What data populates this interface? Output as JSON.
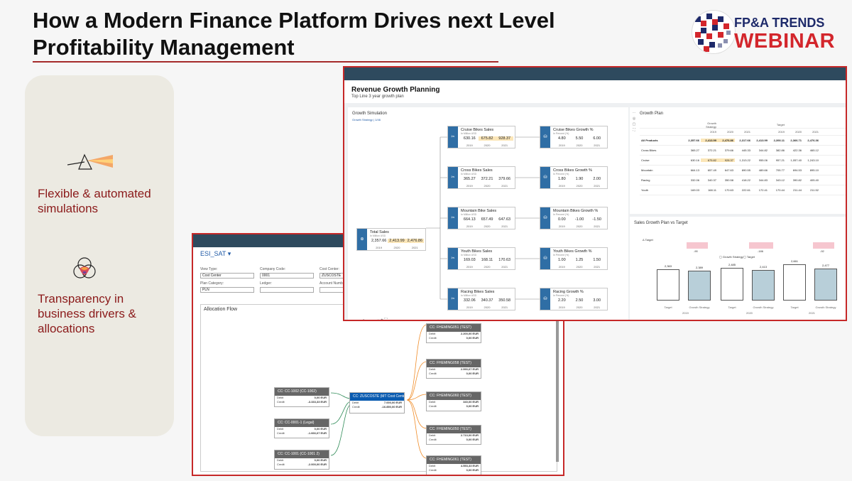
{
  "slide": {
    "title_line1": "How a Modern Finance Platform Drives next Level",
    "title_line2": "Profitability Management"
  },
  "logo": {
    "line1": "FP&A TRENDS",
    "line2": "WEBINAR"
  },
  "side_panel": {
    "feature1_line1": "Flexible & automated",
    "feature1_line2": "simulations",
    "feature2_line1": "Transparency in",
    "feature2_line2": "business drivers &",
    "feature2_line3": "allocations",
    "icon1": "prism-icon",
    "icon2": "venn-icon"
  },
  "colors": {
    "accent_red": "#a52a2a",
    "shell_bar": "#2e4a5e",
    "node_blue": "#2f6ea5",
    "highlight": "#fbe6b8"
  },
  "revenue_app": {
    "title": "Revenue Growth Planning",
    "subtitle": "Top Line 3 year growth plan",
    "simulation": {
      "title": "Growth Simulation",
      "subtitle": "Growth Strategy | 1/46",
      "total": {
        "name": "Total Sales",
        "unit": "In Million USD",
        "values": [
          "2,357.66",
          "2,413.99",
          "2,476.86"
        ],
        "years": [
          "2019",
          "2020",
          "2021"
        ]
      },
      "sales": [
        {
          "name": "Cruise Bikes Sales",
          "unit": "In Million USD",
          "values": [
            "630.16",
            "675.82",
            "928.37"
          ],
          "years": [
            "2019",
            "2020",
            "2021"
          ]
        },
        {
          "name": "Cross Bikes Sales",
          "unit": "In Million USD",
          "values": [
            "365.27",
            "372.21",
            "379.66"
          ],
          "years": [
            "2019",
            "2020",
            "2021"
          ]
        },
        {
          "name": "Mountain Bike Sales",
          "unit": "In Million USD",
          "values": [
            "664.13",
            "657.49",
            "647.63"
          ],
          "years": [
            "2019",
            "2020",
            "2021"
          ]
        },
        {
          "name": "Youth Bikes Sales",
          "unit": "In Million USD",
          "values": [
            "169.03",
            "168.11",
            "170.63"
          ],
          "years": [
            "2019",
            "2020",
            "2021"
          ]
        },
        {
          "name": "Racing Bikes Sales",
          "unit": "In Million USD",
          "values": [
            "332.06",
            "340.37",
            "350.58"
          ],
          "years": [
            "2019",
            "2020",
            "2021"
          ]
        }
      ],
      "growth": [
        {
          "name": "Cruise Bikes Growth %",
          "unit": "In Percent (%)",
          "values": [
            "4.80",
            "5.50",
            "6.00"
          ],
          "years": [
            "2019",
            "2020",
            "2021"
          ]
        },
        {
          "name": "Cross Bikes Growth %",
          "unit": "In Percent (%)",
          "values": [
            "1.80",
            "1.90",
            "2.00"
          ],
          "years": [
            "2019",
            "2020",
            "2021"
          ]
        },
        {
          "name": "Mountain Bikes Growth %",
          "unit": "In Percent (%)",
          "values": [
            "0.00",
            "-1.00",
            "-1.50"
          ],
          "years": [
            "2019",
            "2020",
            "2021"
          ]
        },
        {
          "name": "Youth Bikes Growth %",
          "unit": "In Percent (%)",
          "values": [
            "1.00",
            "1.25",
            "1.50"
          ],
          "years": [
            "2019",
            "2020",
            "2021"
          ]
        },
        {
          "name": "Racing Growth %",
          "unit": "In Percent (%)",
          "values": [
            "2.20",
            "2.50",
            "3.00"
          ],
          "years": [
            "2019",
            "2020",
            "2021"
          ]
        }
      ]
    },
    "growth_plan": {
      "title": "Growth Plan",
      "groups": [
        "Growth Strategy",
        "Target"
      ],
      "years": [
        "2019",
        "2020",
        "2021",
        "2019",
        "2020",
        "2021"
      ],
      "rows": [
        {
          "label": "All Products",
          "cells": [
            "2,357.66",
            "2,413.99",
            "2,476.86",
            "2,317.66",
            "2,413.99",
            "2,393.11",
            "2,366.71",
            "2,476.36"
          ]
        },
        {
          "label": "Cross Bikes",
          "cells": [
            "365.27",
            "372.21",
            "379.66",
            "445.33",
            "344.82",
            "382.86",
            "422.36",
            "465.12"
          ]
        },
        {
          "label": "Cruise",
          "cells": [
            "630.16",
            "675.82",
            "928.37",
            "1,313.22",
            "955.06",
            "957.21",
            "1,057.40",
            "1,243.10"
          ]
        },
        {
          "label": "Mountain",
          "cells": [
            "664.13",
            "657.49",
            "647.63",
            "890.55",
            "489.66",
            "705.77",
            "694.53",
            "895.10"
          ]
        },
        {
          "label": "Racing",
          "cells": [
            "332.06",
            "340.37",
            "350.58",
            "418.22",
            "344.83",
            "343.12",
            "390.82",
            "405.40"
          ]
        },
        {
          "label": "Youth",
          "cells": [
            "169.03",
            "168.11",
            "170.63",
            "222.61",
            "172.41",
            "170.44",
            "211.44",
            "211.52"
          ]
        }
      ]
    },
    "sales_growth": {
      "title": "Sales Growth Plan vs Target",
      "target_label": "Δ Target",
      "deltas": [
        "-90",
        "-186",
        "-92"
      ],
      "legend": [
        "Growth Strategy",
        "Target"
      ],
      "bars": [
        "2,363",
        "2,389",
        "2,485",
        "2,413",
        "2,661",
        "2,477"
      ],
      "bar_labels": [
        "Target",
        "Growth Strategy",
        "Target",
        "Growth Strategy",
        "Target",
        "Growth Strategy"
      ],
      "years": [
        "2019",
        "2020",
        "2021"
      ]
    }
  },
  "allocation_app": {
    "view_name": "ESI_SAT",
    "fields": {
      "view_type_label": "View Type:",
      "view_type_value": "Cost Center",
      "company_code_label": "Company Code:",
      "company_code_value": "0001",
      "cost_center_label": "Cost Center:",
      "cost_center_value": "ZUSCOSTE",
      "plan_category_label": "Plan Category:",
      "plan_category_value": "PLN",
      "ledger_label": "Ledger:",
      "account_label": "Account Number"
    },
    "flow_title": "Allocation Flow",
    "debit_label": "Debit",
    "credit_label": "Credit",
    "sources": [
      {
        "name": "CC: CC-1002 (CC-1002)",
        "debit": "0,00 EUR",
        "credit": "-3.333,33 EUR"
      },
      {
        "name": "CC: CC-0001-1 (Legal)",
        "debit": "0,00 EUR",
        "credit": "-1.666,67 EUR"
      },
      {
        "name": "CC: CC-1001 (CC-1001 2)",
        "debit": "0,00 EUR",
        "credit": "-2.000,00 EUR"
      }
    ],
    "center": {
      "name": "CC: ZUSCOSTE (MT Cost Center)",
      "debit": "7.000,00 EUR",
      "credit": "-16.850,00 EUR"
    },
    "targets": [
      {
        "name": "CC: FHEMING051 (TEST)",
        "debit": "2.200,00 EUR",
        "credit": "0,00 EUR"
      },
      {
        "name": "CC: FHEMING058 (TEST)",
        "debit": "2.990,67 EUR",
        "credit": "0,00 EUR"
      },
      {
        "name": "CC: FHEMING060 (TEST)",
        "debit": "340,00 EUR",
        "credit": "0,00 EUR"
      },
      {
        "name": "CC: FHEMING050 (TEST)",
        "debit": "2.710,00 EUR",
        "credit": "0,00 EUR"
      },
      {
        "name": "CC: FHEMING061 (TEST)",
        "debit": "4.553,33 EUR",
        "credit": "0,00 EUR"
      }
    ]
  }
}
